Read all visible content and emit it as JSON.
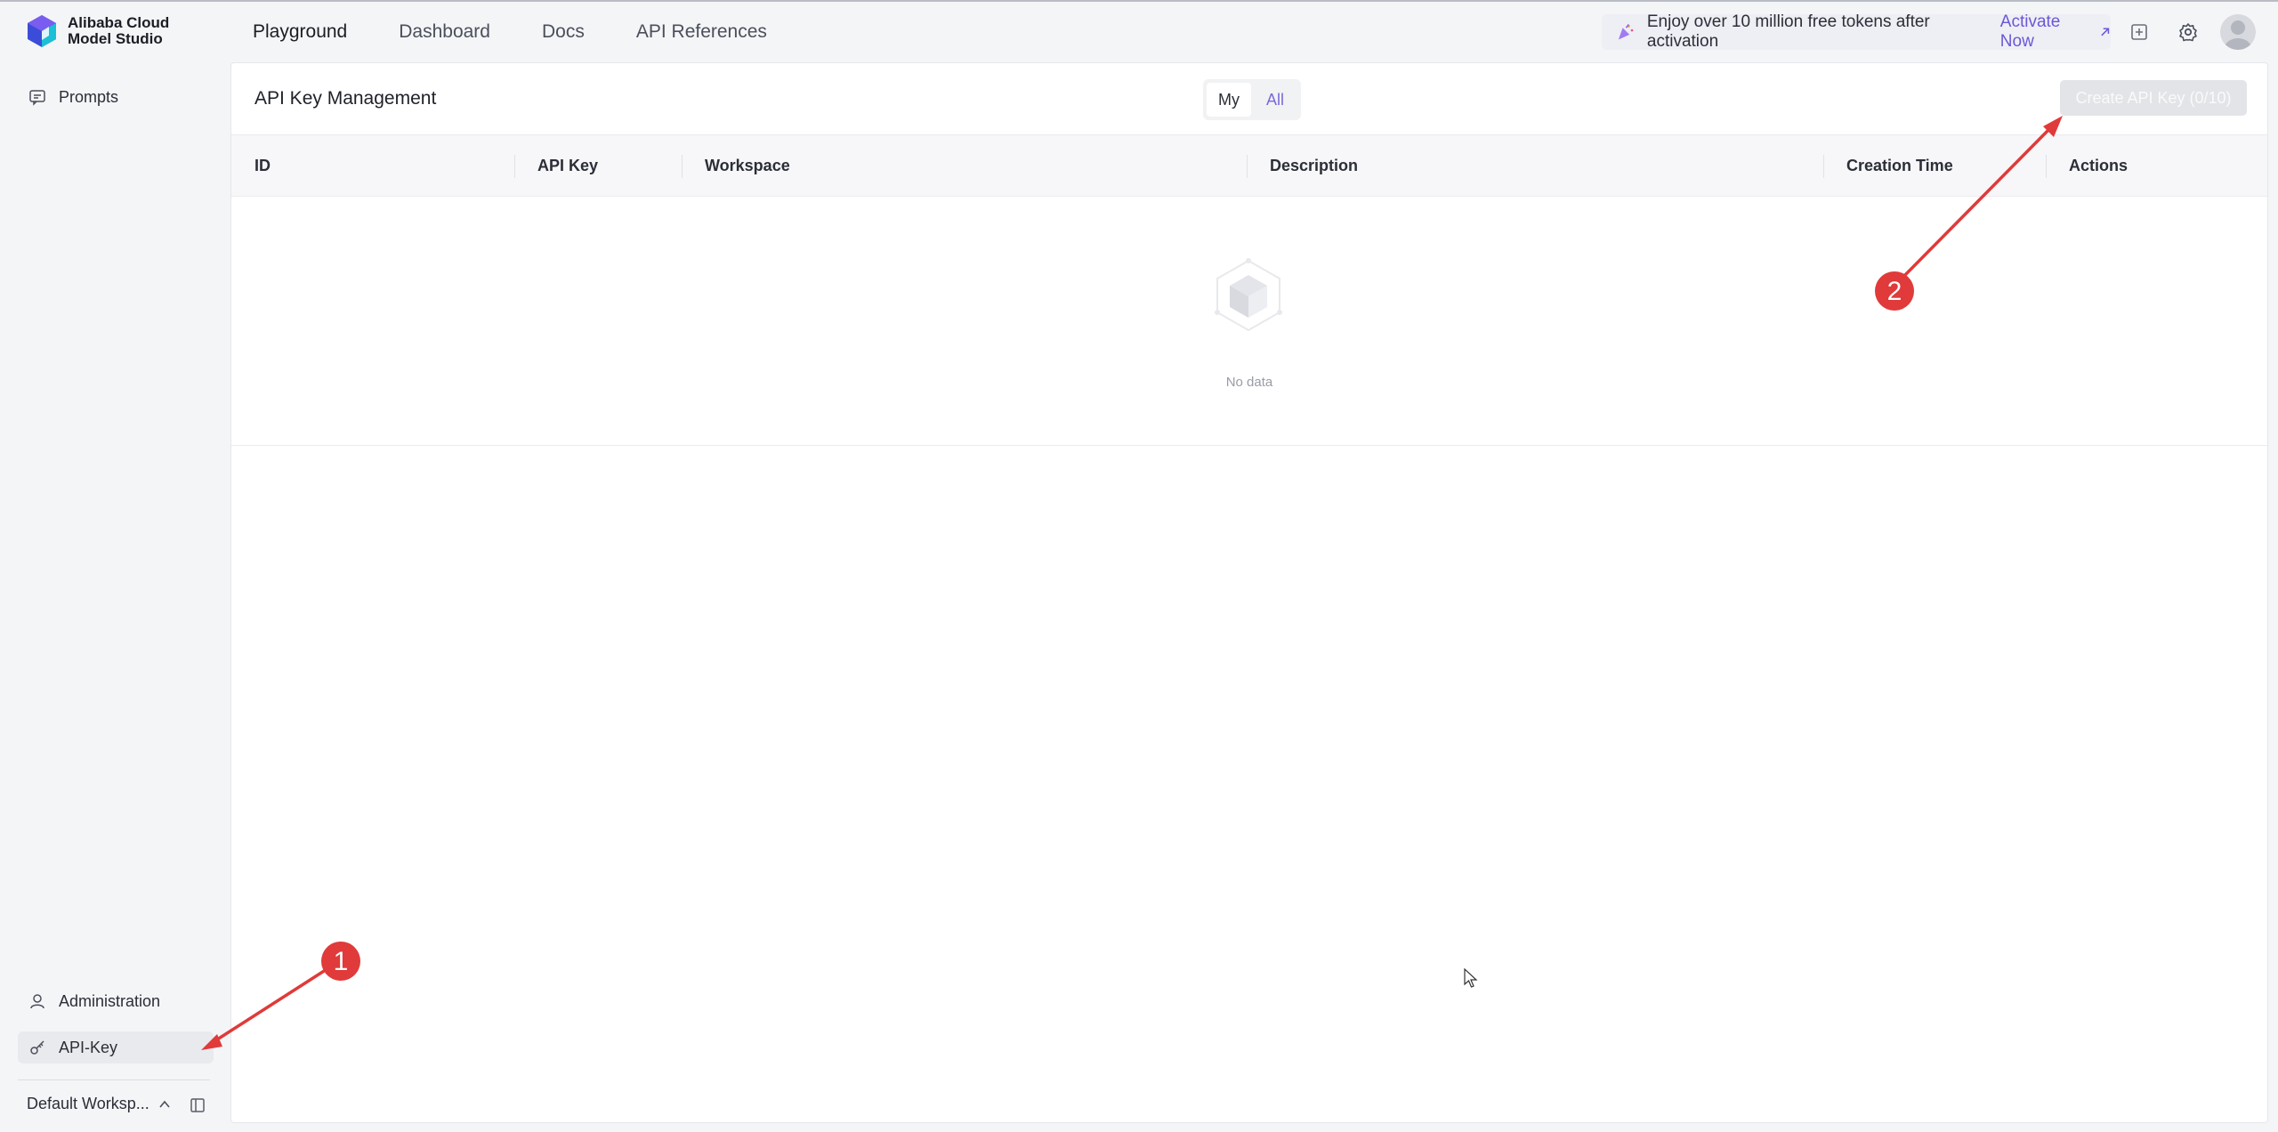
{
  "brand": {
    "line1": "Alibaba Cloud",
    "line2": "Model Studio"
  },
  "nav": [
    {
      "label": "Playground",
      "active": true
    },
    {
      "label": "Dashboard"
    },
    {
      "label": "Docs"
    },
    {
      "label": "API References"
    }
  ],
  "promo": {
    "text": "Enjoy over 10 million free tokens after activation",
    "link": "Activate Now",
    "link_icon": "arrow-up-right-icon"
  },
  "header_icons": [
    "layout-icon",
    "gear-icon",
    "avatar"
  ],
  "sidebar": {
    "items": [
      {
        "label": "Prompts",
        "icon": "message-icon"
      },
      {
        "label": "Administration",
        "icon": "user-icon"
      },
      {
        "label": "API-Key",
        "icon": "key-icon",
        "active": true
      }
    ],
    "workspace": "Default Worksp...",
    "workspace_icon": "chevron-up-icon"
  },
  "main": {
    "title": "API Key Management",
    "segment": [
      {
        "label": "My",
        "active": true
      },
      {
        "label": "All"
      }
    ],
    "create_button": "Create API Key (0/10)",
    "columns": [
      "ID",
      "API Key",
      "Workspace",
      "Description",
      "Creation Time",
      "Actions"
    ],
    "rows": [],
    "empty_text": "No data"
  },
  "annotations": {
    "one": "1",
    "two": "2"
  },
  "colors": {
    "accent": "#6b57d6",
    "annotation": "#e03a3a"
  }
}
